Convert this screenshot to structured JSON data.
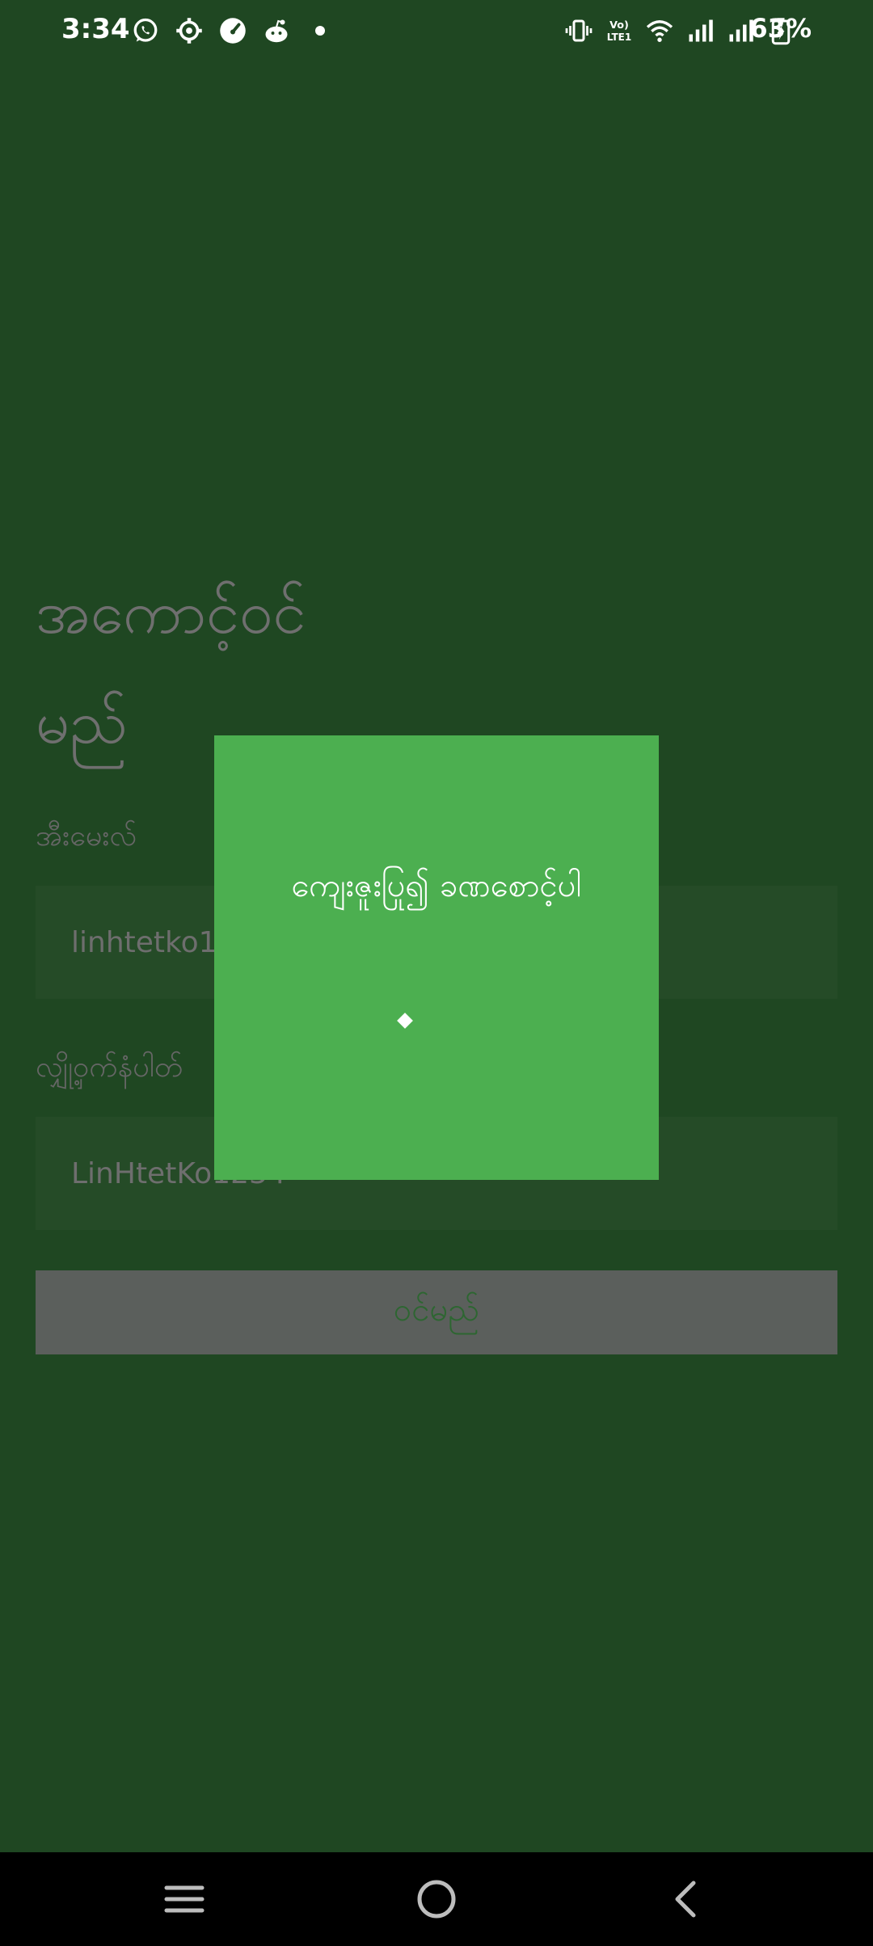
{
  "status_bar": {
    "time": "3:34",
    "battery_percent": "63%",
    "left_icons": [
      "whatsapp-icon",
      "settings-icon",
      "speedometer-icon",
      "reddit-icon",
      "dot-icon"
    ],
    "right_icons": [
      "vibrate-icon",
      "volte-icon",
      "wifi-icon",
      "signal-icon",
      "signal-icon",
      "battery-charging-icon"
    ]
  },
  "login": {
    "title": "အကောင့်ဝင်မည်",
    "email_label": "အီးမေးလ်",
    "email_value": "linhtetko1",
    "password_label": "လျှို့ဝှက်နံပါတ်",
    "password_value": "LinHtetKo1234",
    "login_button": "ဝင်မည်"
  },
  "dialog": {
    "message": "ကျေးဇူးပြု၍ ခဏစောင့်ပါ"
  },
  "nav_bar": {
    "icons": [
      "recents-icon",
      "home-icon",
      "back-icon"
    ]
  },
  "colors": {
    "background": "#1f4722",
    "dialog": "#4caf50",
    "button": "#5b5f5c"
  }
}
